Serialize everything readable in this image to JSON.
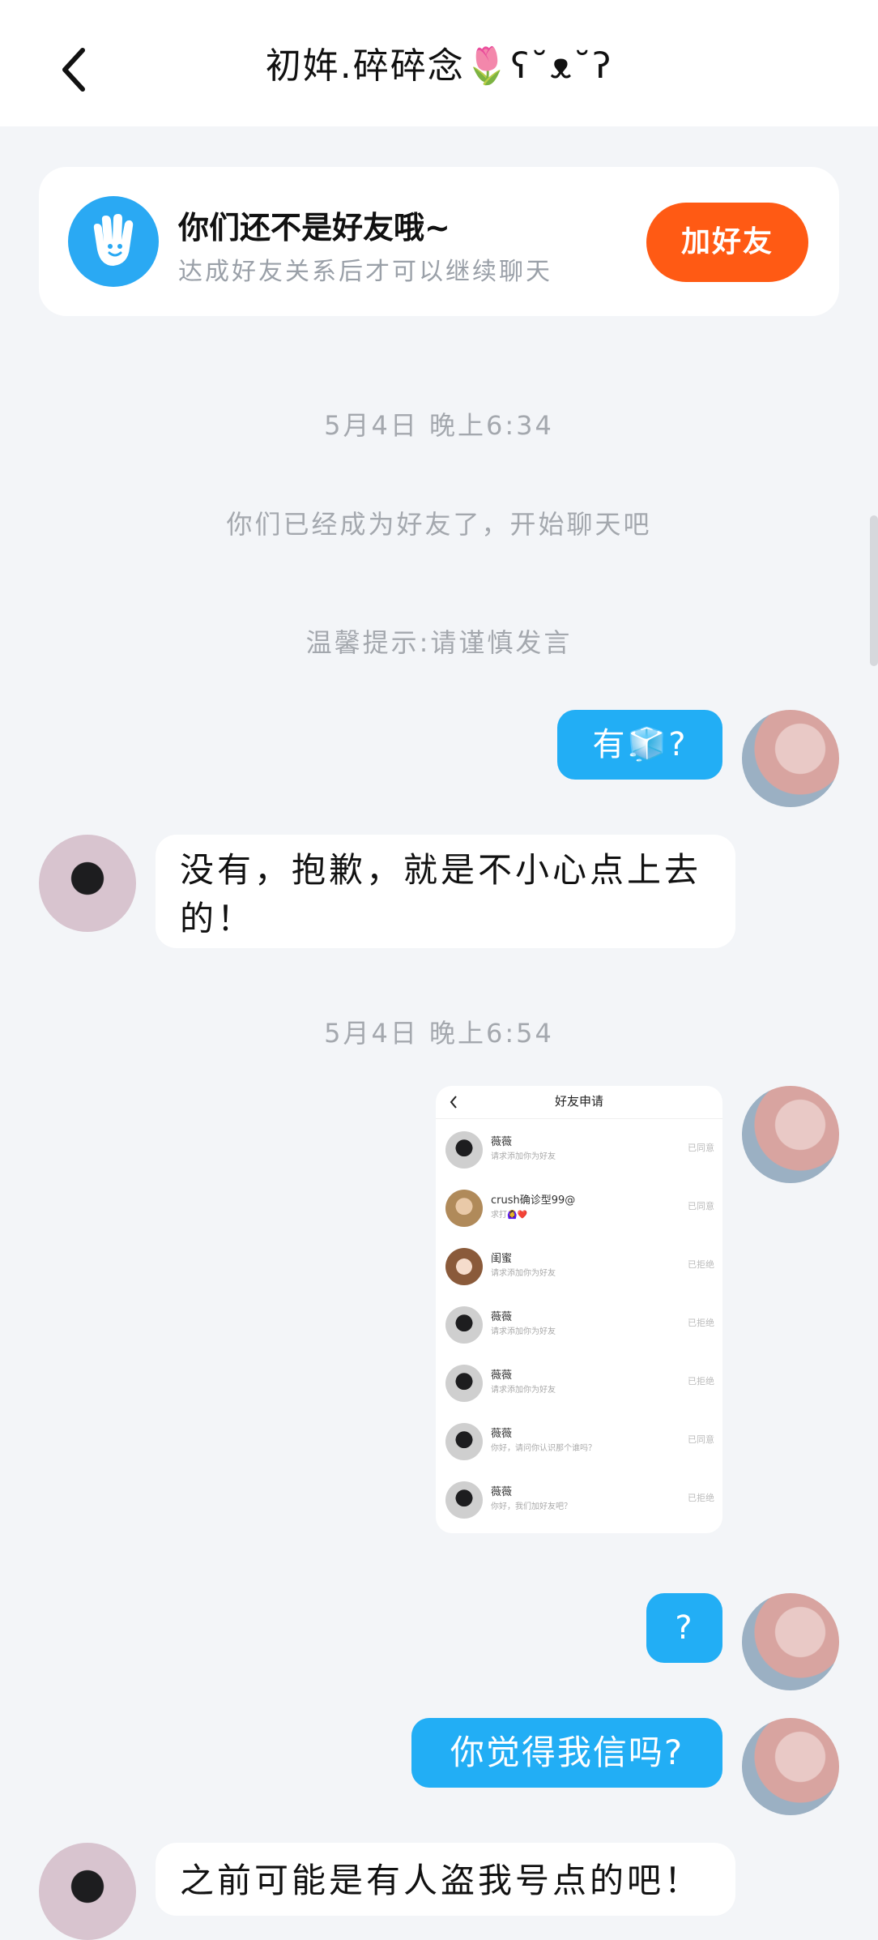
{
  "header": {
    "title": "初姩.碎碎念🌷ʕ˘ᴥ˘ʔ"
  },
  "friend_card": {
    "title": "你们还不是好友哦~",
    "subtitle": "达成好友关系后才可以继续聊天",
    "add_button": "加好友"
  },
  "system": {
    "time1": "5月4日 晚上6:34",
    "friends_now": "你们已经成为好友了，开始聊天吧",
    "warning": "温馨提示:请谨慎发言",
    "time2": "5月4日 晚上6:54"
  },
  "messages": {
    "m1_text": "有",
    "m1_emoji": "🧊",
    "m1_q": "?",
    "m2": "没有，抱歉，就是不小心点上去的！",
    "m3": "?",
    "m4": "你觉得我信吗?",
    "m5": "之前可能是有人盗我号点的吧！"
  },
  "screenshot": {
    "title": "好友申请",
    "rows": [
      {
        "name": "薇薇",
        "msg": "请求添加你为好友",
        "status": "已同意"
      },
      {
        "name": "crush确诊型99@",
        "msg": "求打🙆‍♀️❤️",
        "status": "已同意"
      },
      {
        "name": "闺蜜",
        "msg": "请求添加你为好友",
        "status": "已拒绝"
      },
      {
        "name": "薇薇",
        "msg": "请求添加你为好友",
        "status": "已拒绝"
      },
      {
        "name": "薇薇",
        "msg": "请求添加你为好友",
        "status": "已拒绝"
      },
      {
        "name": "薇薇",
        "msg": "你好，请问你认识那个谁吗？",
        "status": "已同意"
      },
      {
        "name": "薇薇",
        "msg": "你好，我们加好友吧？",
        "status": "已拒绝"
      }
    ]
  }
}
